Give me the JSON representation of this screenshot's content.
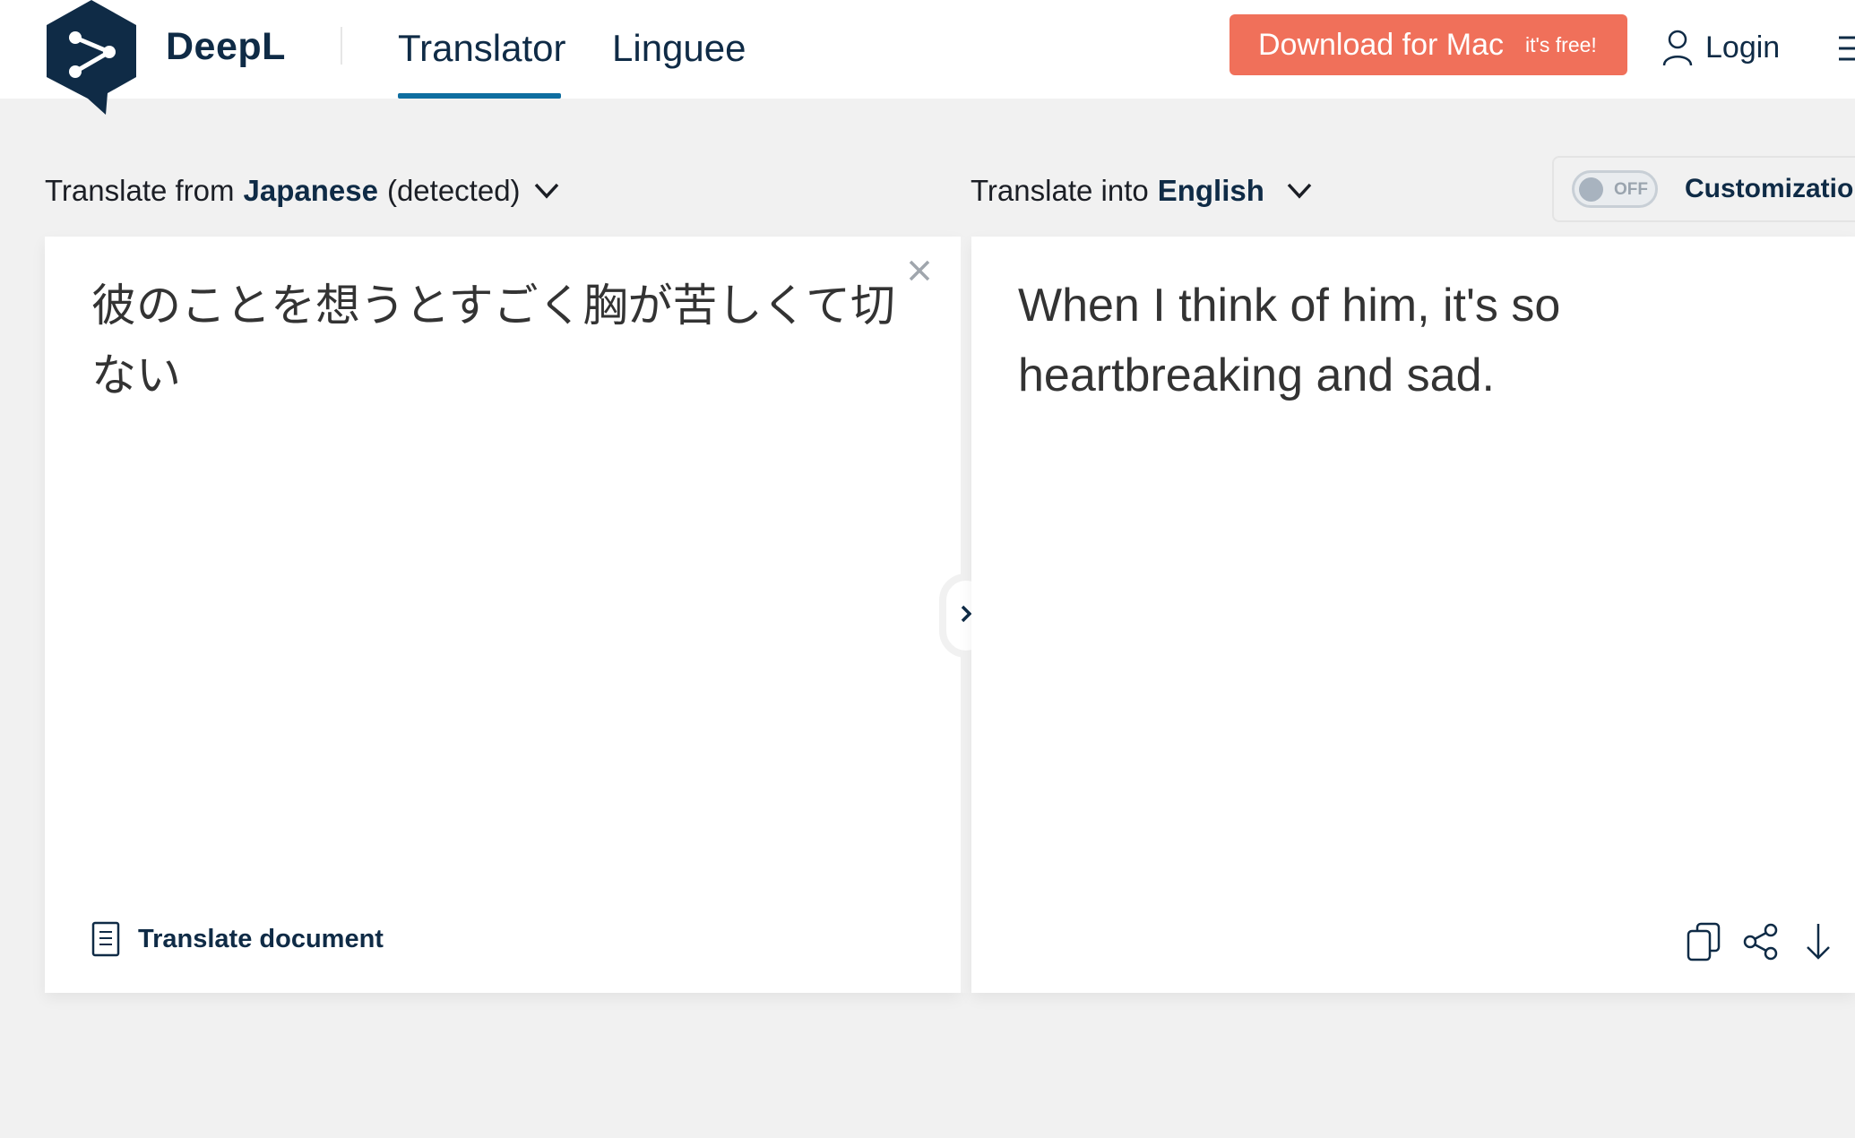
{
  "header": {
    "brand": "DeepL",
    "tabs": [
      {
        "label": "Translator",
        "active": true
      },
      {
        "label": "Linguee",
        "active": false
      }
    ],
    "download": {
      "label": "Download for Mac",
      "sub": "it's free!"
    },
    "login_label": "Login"
  },
  "language_bar": {
    "from_prefix": "Translate from",
    "from_lang": "Japanese",
    "from_suffix": "(detected)",
    "to_prefix": "Translate into",
    "to_lang": "English",
    "toggle_state": "OFF",
    "customization_label": "Customization"
  },
  "source": {
    "text": "彼のことを想うとすごく胸が苦しくて切ない",
    "translate_document_label": "Translate document"
  },
  "target": {
    "text": "When I think of him, it's so heartbreaking and sad."
  },
  "colors": {
    "brand_navy": "#0f2b46",
    "accent_blue": "#0f6ea0",
    "download_orange": "#f0705a",
    "background": "#f1f1f1"
  },
  "icons": {
    "logo": "deepl-logo-icon",
    "login": "user-icon",
    "menu": "hamburger-icon",
    "chevron": "chevron-down-icon",
    "clear": "close-icon",
    "document": "document-icon",
    "swap": "chevron-right-icon",
    "copy": "copy-icon",
    "share": "share-icon",
    "download": "download-icon"
  }
}
